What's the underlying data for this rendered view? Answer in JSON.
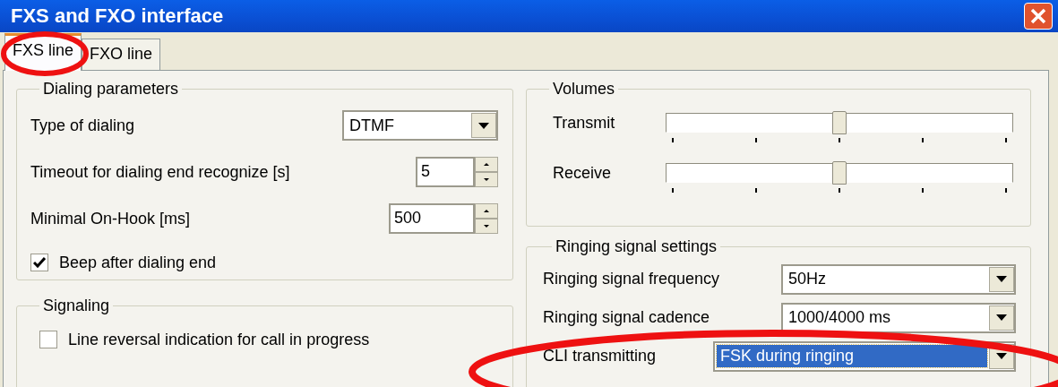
{
  "window": {
    "title": "FXS and FXO interface"
  },
  "tabs": [
    {
      "label": "FXS line",
      "selected": true
    },
    {
      "label": "FXO line",
      "selected": false
    }
  ],
  "dialing": {
    "title": "Dialing parameters",
    "fields": [
      {
        "kind": "dropdown",
        "label": "Type of dialing",
        "value": "DTMF"
      },
      {
        "kind": "spinner",
        "label": "Timeout for dialing end recognize [s]",
        "value": "5"
      },
      {
        "kind": "spinner",
        "label": "Minimal On-Hook [ms]",
        "value": "500"
      },
      {
        "kind": "checkbox",
        "label": "Beep after dialing end",
        "checked": true
      }
    ]
  },
  "signaling": {
    "title": "Signaling",
    "options": [
      {
        "label": "Line reversal indication for call in progress",
        "checked": false
      }
    ]
  },
  "volumes": {
    "title": "Volumes",
    "sliders": [
      {
        "label": "Transmit",
        "level": 0.5
      },
      {
        "label": "Receive",
        "level": 0.5
      }
    ]
  },
  "ringing": {
    "title": "Ringing signal settings",
    "fields": [
      {
        "label": "Ringing signal frequency",
        "value": "50Hz",
        "selected": false,
        "wide": false
      },
      {
        "label": "Ringing signal cadence",
        "value": "1000/4000 ms",
        "selected": false,
        "wide": false
      },
      {
        "label": "CLI transmitting",
        "value": "FSK during ringing",
        "selected": true,
        "wide": true
      }
    ]
  }
}
